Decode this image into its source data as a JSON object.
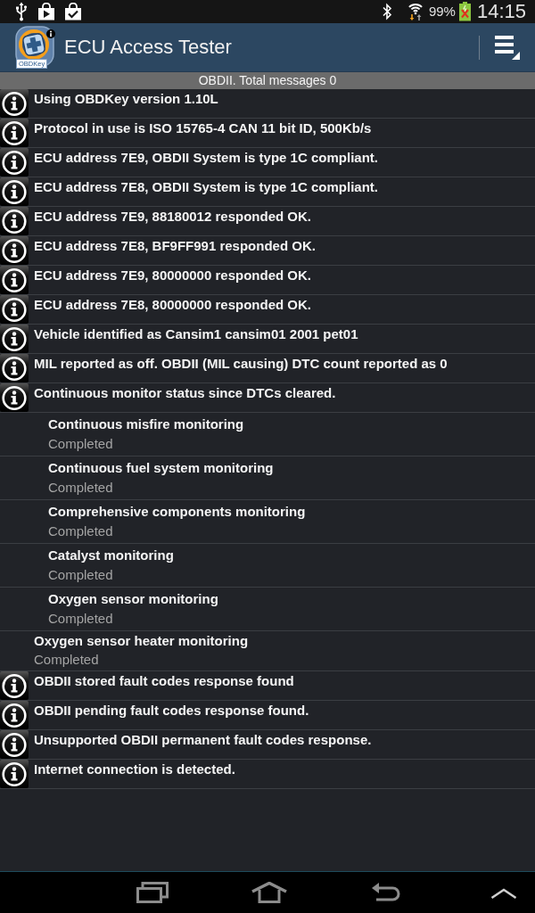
{
  "status_bar": {
    "battery_percent": "99%",
    "time": "14:15"
  },
  "action_bar": {
    "logo_label": "OBDKey",
    "title": "ECU Access Tester"
  },
  "summary": "OBDII. Total messages 0",
  "messages": [
    {
      "kind": "info",
      "text": "Using OBDKey version 1.10L"
    },
    {
      "kind": "info",
      "text": "Protocol in use is ISO 15765-4 CAN 11 bit ID, 500Kb/s"
    },
    {
      "kind": "info",
      "text": "ECU address 7E9, OBDII System is type 1C compliant."
    },
    {
      "kind": "info",
      "text": "ECU address 7E8, OBDII System is type 1C compliant."
    },
    {
      "kind": "info",
      "text": "ECU address 7E9, 88180012 responded OK."
    },
    {
      "kind": "info",
      "text": "ECU address 7E8, BF9FF991 responded OK."
    },
    {
      "kind": "info",
      "text": "ECU address 7E9, 80000000 responded OK."
    },
    {
      "kind": "info",
      "text": "ECU address 7E8, 80000000 responded OK."
    },
    {
      "kind": "info",
      "text": "Vehicle identified as Cansim1 cansim01 2001 pet01"
    },
    {
      "kind": "info",
      "text": "MIL reported as off. OBDII (MIL causing) DTC count reported as 0"
    },
    {
      "kind": "info",
      "text": "Continuous monitor status since DTCs cleared.",
      "children": [
        {
          "kind": "monitor",
          "title": "Continuous misfire monitoring",
          "status": "Completed"
        },
        {
          "kind": "monitor",
          "title": "Continuous fuel system monitoring",
          "status": "Completed"
        },
        {
          "kind": "monitor",
          "title": "Comprehensive components monitoring",
          "status": "Completed"
        },
        {
          "kind": "monitor",
          "title": "Catalyst monitoring",
          "status": "Completed"
        },
        {
          "kind": "monitor",
          "title": "Oxygen sensor monitoring",
          "status": "Completed"
        }
      ]
    },
    {
      "kind": "monitor",
      "title": "Oxygen sensor heater monitoring",
      "status": "Completed"
    },
    {
      "kind": "info",
      "text": "OBDII stored fault codes response found"
    },
    {
      "kind": "info",
      "text": "OBDII pending fault codes response found."
    },
    {
      "kind": "info",
      "text": "Unsupported OBDII permanent fault codes response."
    },
    {
      "kind": "info",
      "text": "Internet connection is detected."
    }
  ]
}
